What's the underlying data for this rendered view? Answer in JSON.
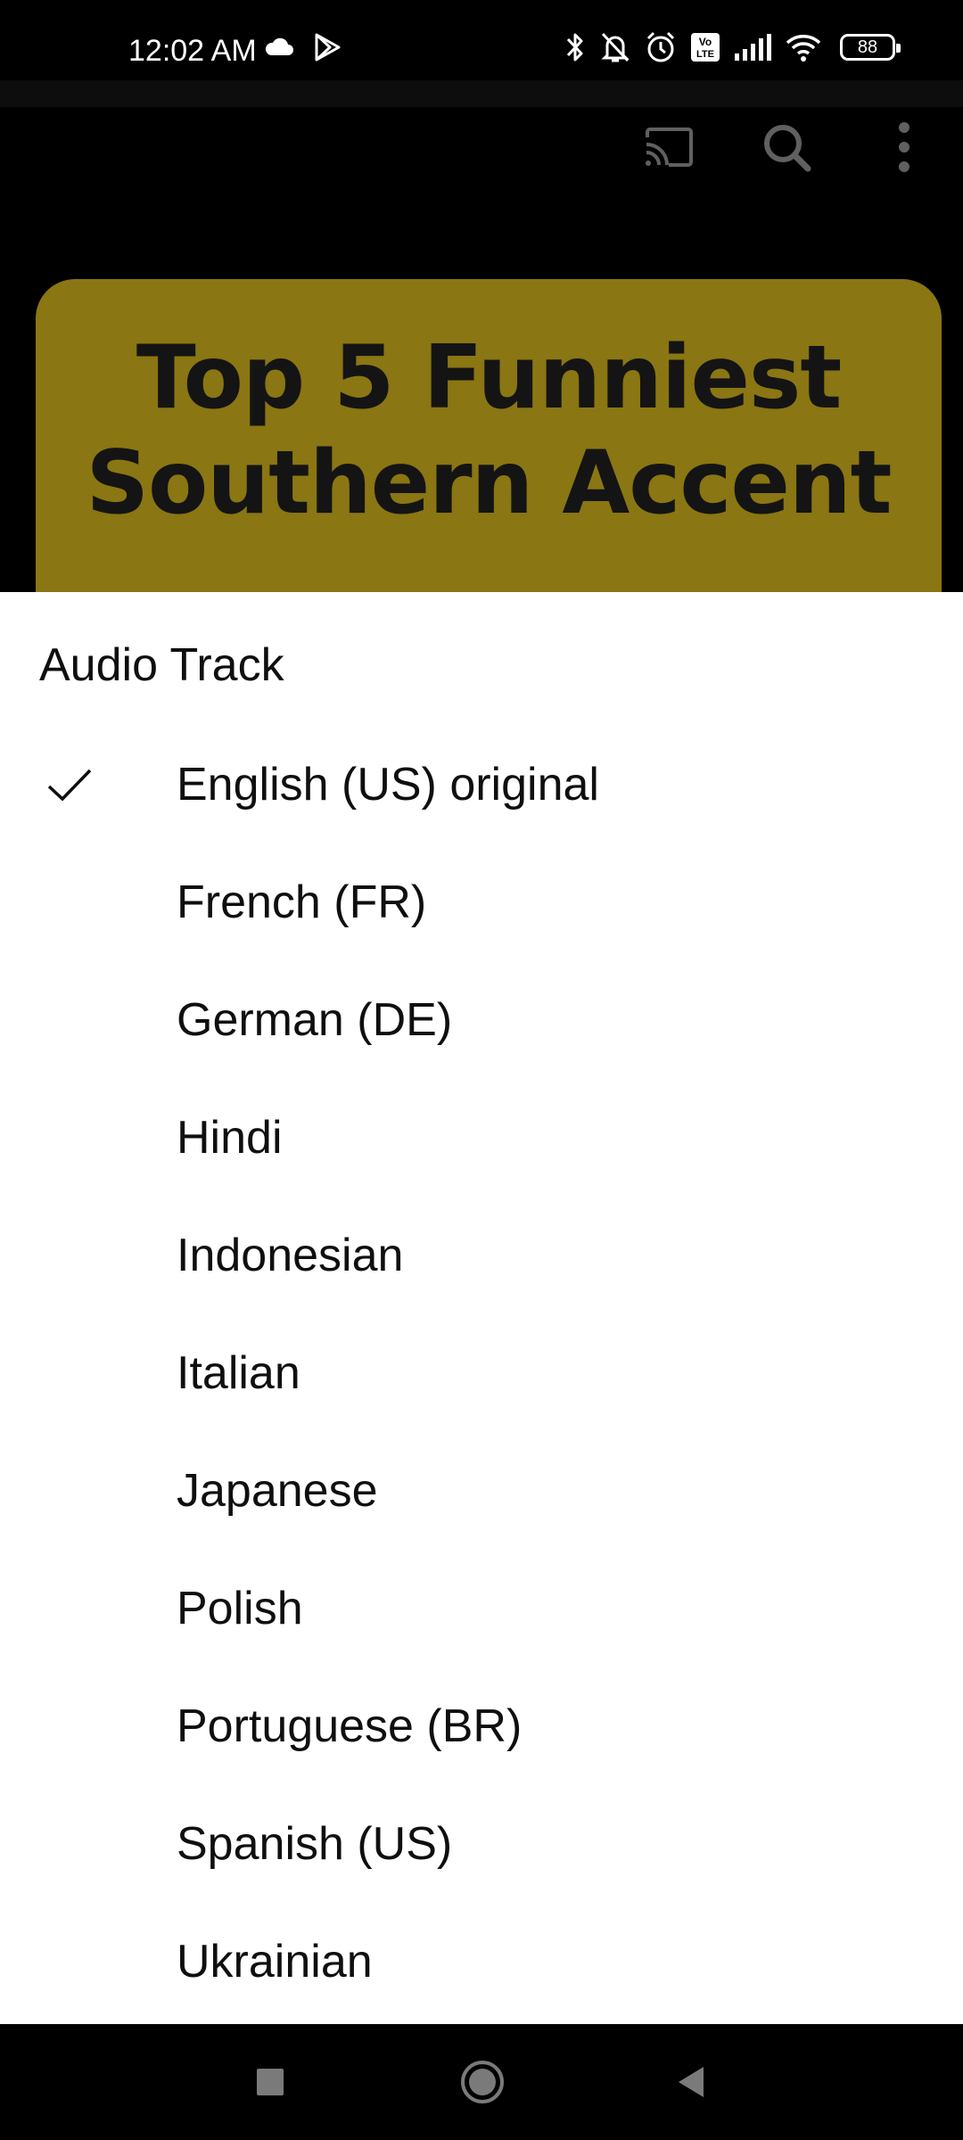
{
  "status_bar": {
    "time": "12:02 AM",
    "left_icons": [
      "cloud-icon",
      "play-store-icon"
    ],
    "right_icons": [
      "bluetooth-icon",
      "bell-muted-icon",
      "alarm-icon",
      "volte-icon",
      "signal-icon",
      "wifi-icon"
    ],
    "volte_label": "Vo LTE",
    "battery_level": "88"
  },
  "app_bar": {
    "icons": [
      "cast-icon",
      "search-icon",
      "more-vert-icon"
    ]
  },
  "video": {
    "thumbnail_line1": "Top 5 Funniest",
    "thumbnail_line2": "Southern Accent",
    "thumbnail_color": "#8a7612"
  },
  "sheet": {
    "title": "Audio Track",
    "selected_index": 0,
    "items": [
      {
        "label": "English (US) original"
      },
      {
        "label": "French (FR)"
      },
      {
        "label": "German (DE)"
      },
      {
        "label": "Hindi"
      },
      {
        "label": "Indonesian"
      },
      {
        "label": "Italian"
      },
      {
        "label": "Japanese"
      },
      {
        "label": "Polish"
      },
      {
        "label": "Portuguese (BR)"
      },
      {
        "label": "Spanish (US)"
      },
      {
        "label": "Ukrainian"
      }
    ]
  },
  "nav_bar": {
    "buttons": [
      "recents-button",
      "home-button",
      "back-button"
    ]
  }
}
